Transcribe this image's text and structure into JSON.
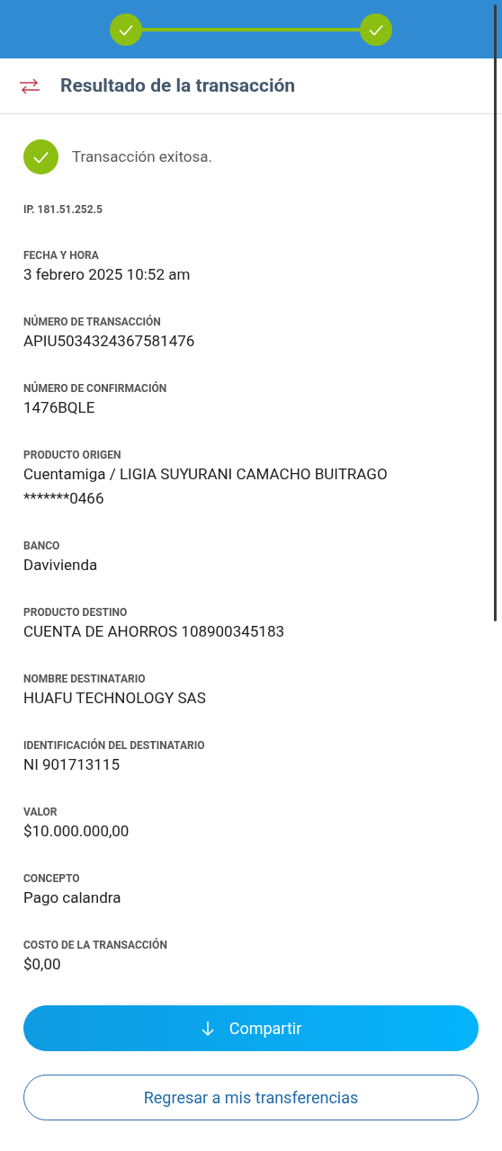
{
  "steps": [
    {
      "done": true
    },
    {
      "done": true
    }
  ],
  "header": {
    "title": "Resultado de la transacción"
  },
  "status": {
    "success": true,
    "message": "Transacción exitosa."
  },
  "ip": "IP. 181.51.252.5",
  "fields": [
    {
      "label": "FECHA Y HORA",
      "lines": [
        "3 febrero 2025 10:52 am"
      ]
    },
    {
      "label": "NÚMERO DE TRANSACCIÓN",
      "lines": [
        "APIU5034324367581476"
      ]
    },
    {
      "label": "NÚMERO DE CONFIRMACIÓN",
      "lines": [
        "1476BQLE"
      ]
    },
    {
      "label": "PRODUCTO ORIGEN",
      "lines": [
        "Cuentamiga / LIGIA SUYURANI CAMACHO BUITRAGO",
        "*******0466"
      ]
    },
    {
      "label": "BANCO",
      "lines": [
        "Davivienda"
      ]
    },
    {
      "label": "PRODUCTO DESTINO",
      "lines": [
        "CUENTA DE AHORROS 108900345183"
      ]
    },
    {
      "label": "NOMBRE DESTINATARIO",
      "lines": [
        "HUAFU TECHNOLOGY SAS"
      ]
    },
    {
      "label": "IDENTIFICACIÓN DEL DESTINATARIO",
      "lines": [
        "NI 901713115"
      ]
    },
    {
      "label": "VALOR",
      "lines": [
        "$10.000.000,00"
      ]
    },
    {
      "label": "CONCEPTO",
      "lines": [
        "Pago calandra"
      ]
    },
    {
      "label": "COSTO DE LA TRANSACCIÓN",
      "lines": [
        "$0,00"
      ]
    }
  ],
  "buttons": {
    "share": "Compartir",
    "back": "Regresar a mis transferencias"
  }
}
